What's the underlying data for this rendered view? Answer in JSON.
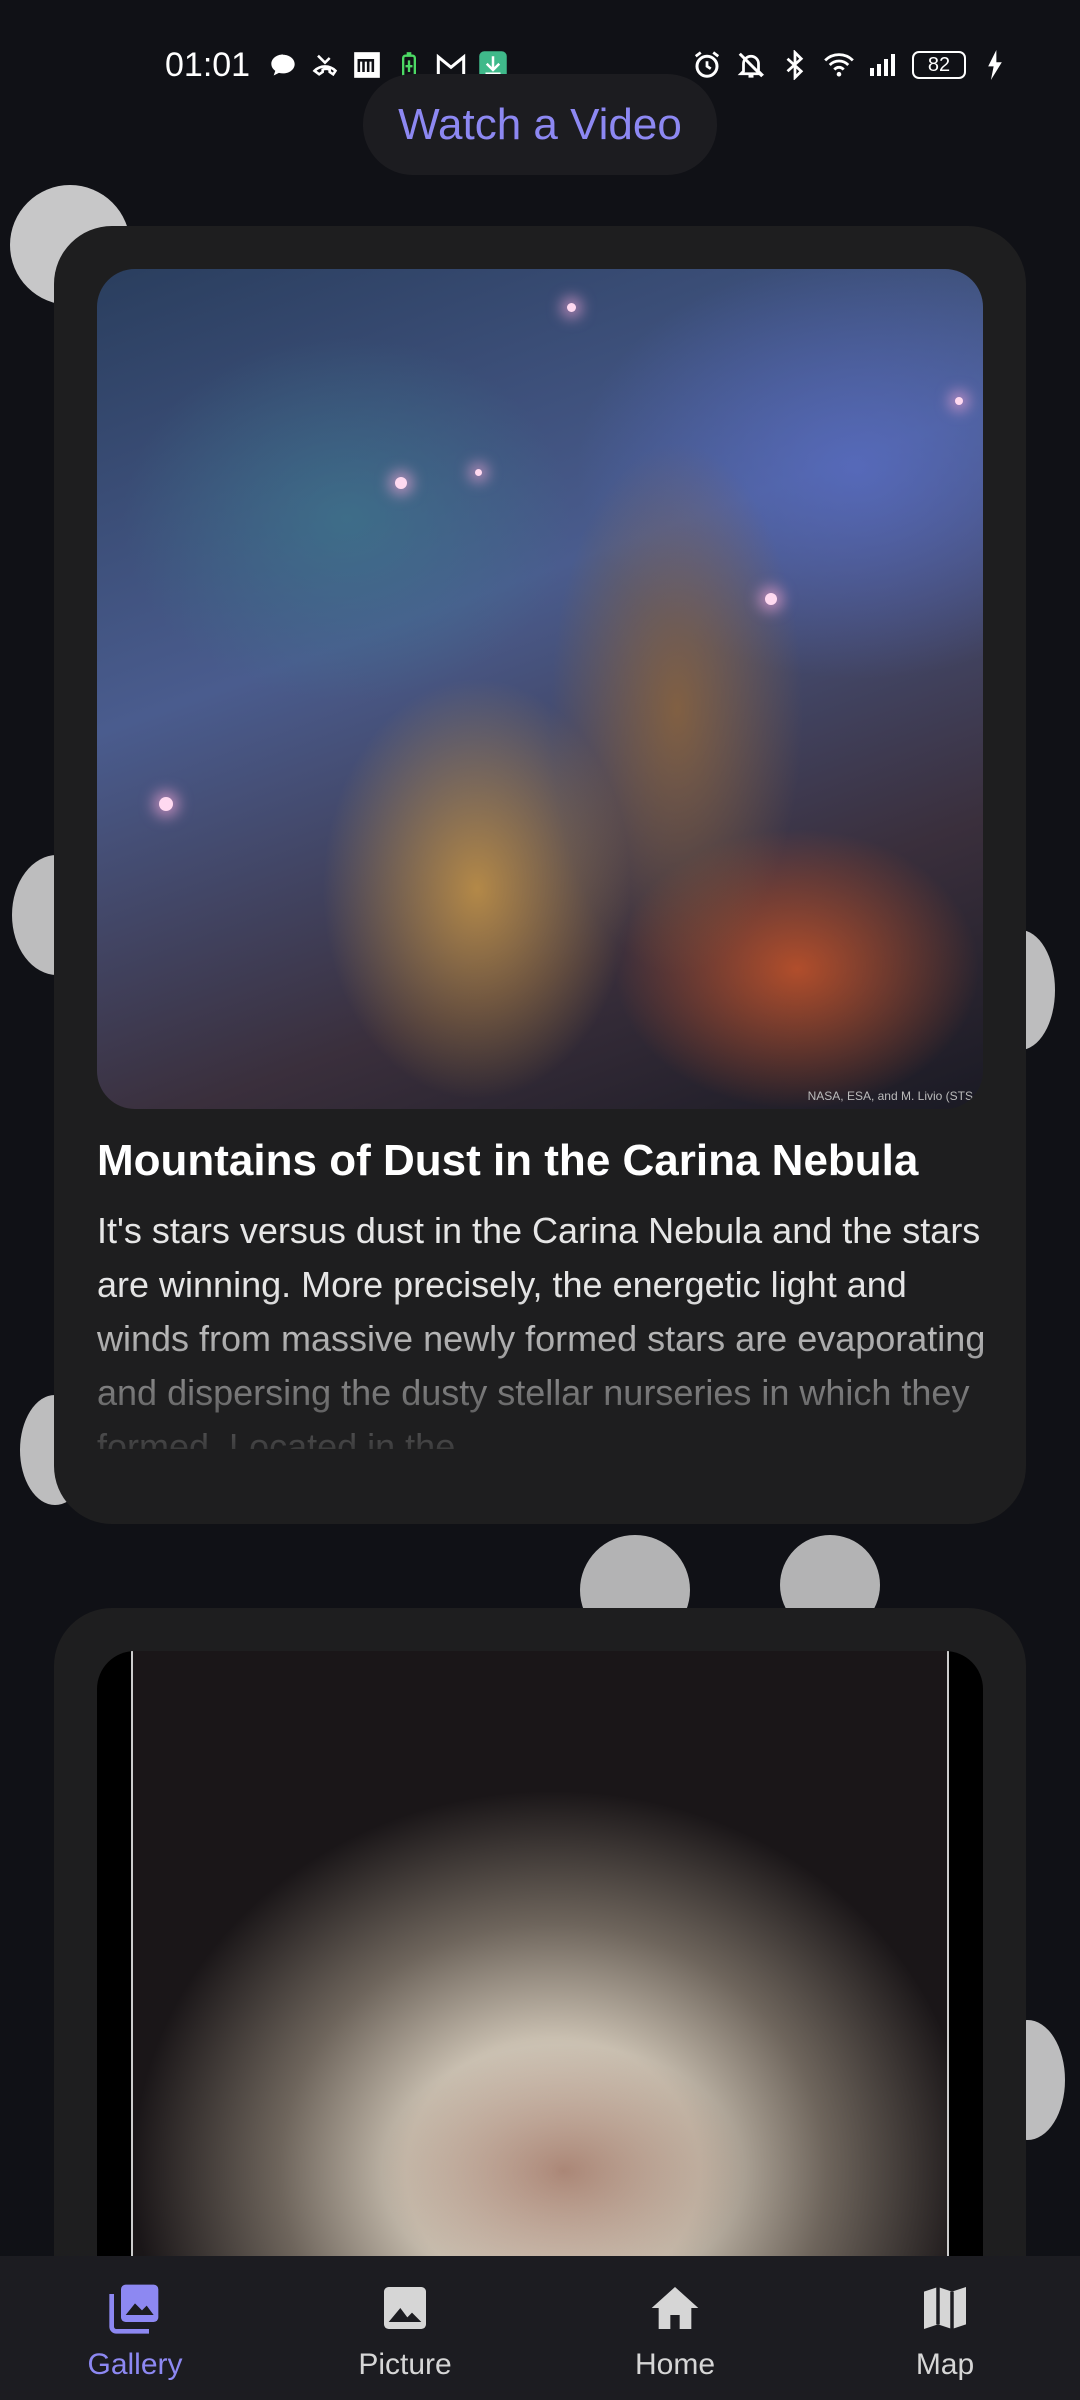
{
  "status_bar": {
    "time": "01:01",
    "battery": "82",
    "left_icons": [
      "chat-bubble-icon",
      "missed-call-icon",
      "m-app-icon",
      "battery-saver-icon",
      "gmail-icon",
      "download-icon"
    ],
    "right_icons": [
      "alarm-icon",
      "mute-icon",
      "bluetooth-icon",
      "wifi-icon",
      "signal-icon",
      "charging-icon"
    ]
  },
  "header": {
    "watch_video_label": "Watch a Video"
  },
  "cards": [
    {
      "image_credit": "NASA, ESA, and M. Livio (STS",
      "title": "Mountains of Dust in the Carina Nebula",
      "description": "It's stars versus dust in the Carina Nebula and the stars are winning. More precisely, the energetic light and winds from massive newly formed stars are evaporating and dispersing the dusty stellar nurseries in which they formed. Located in the"
    },
    {
      "image": "galaxy"
    }
  ],
  "bottom_nav": {
    "items": [
      {
        "label": "Gallery",
        "icon": "gallery-icon",
        "active": true
      },
      {
        "label": "Picture",
        "icon": "picture-icon",
        "active": false
      },
      {
        "label": "Home",
        "icon": "home-icon",
        "active": false
      },
      {
        "label": "Map",
        "icon": "map-icon",
        "active": false
      }
    ]
  },
  "colors": {
    "accent": "#8d88f2",
    "background": "#101116",
    "card": "#1e1e1f"
  }
}
